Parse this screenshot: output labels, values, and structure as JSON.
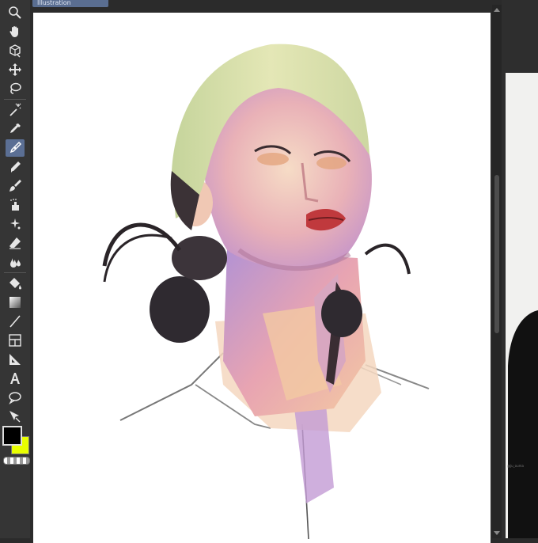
{
  "document": {
    "tab_title": "Illustration"
  },
  "tools": [
    {
      "icon": "zoom-icon",
      "active": false
    },
    {
      "icon": "hand-icon",
      "active": false
    },
    {
      "icon": "rotate-3d-icon",
      "active": false
    },
    {
      "icon": "move-icon",
      "active": false
    },
    {
      "icon": "lasso-icon",
      "active": false
    },
    {
      "icon": "magic-wand-icon",
      "active": false
    },
    {
      "icon": "eyedropper-icon",
      "active": false
    },
    {
      "icon": "pen-icon",
      "active": true
    },
    {
      "icon": "pencil-icon",
      "active": false
    },
    {
      "icon": "brush-icon",
      "active": false
    },
    {
      "icon": "airbrush-icon",
      "active": false
    },
    {
      "icon": "decoration-icon",
      "active": false
    },
    {
      "icon": "eraser-icon",
      "active": false
    },
    {
      "icon": "blend-icon",
      "active": false
    },
    {
      "icon": "fill-icon",
      "active": false
    },
    {
      "icon": "gradient-icon",
      "active": false
    },
    {
      "icon": "line-icon",
      "active": false
    },
    {
      "icon": "frame-border-icon",
      "active": false
    },
    {
      "icon": "ruler-icon",
      "active": false
    },
    {
      "icon": "text-icon",
      "active": false
    },
    {
      "icon": "balloon-icon",
      "active": false
    },
    {
      "icon": "correct-line-icon",
      "active": false
    }
  ],
  "colors": {
    "main": "#000000",
    "sub": "#e9ff00",
    "active_tool_bg": "#5b6f94",
    "toolbar_bg": "#353535"
  },
  "reference": {
    "caption": "@ju_ouma"
  }
}
